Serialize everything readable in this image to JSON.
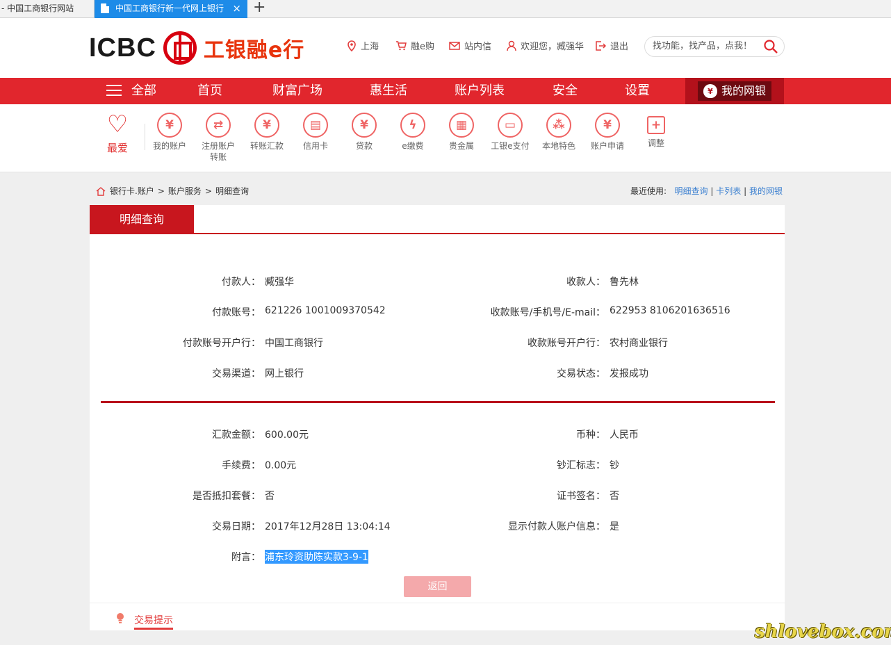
{
  "browser": {
    "prev_tab": "- 中国工商银行网站",
    "active_tab": "中国工商银行新一代网上银行",
    "close_glyph": "×",
    "new_tab_glyph": "+"
  },
  "header": {
    "logo_text": "ICBC",
    "logo_cn": "工银融e行",
    "nav": [
      {
        "icon": "location-pin-icon",
        "label": "上海"
      },
      {
        "icon": "cart-icon",
        "label": "融e购"
      },
      {
        "icon": "mail-icon",
        "label": "站内信"
      },
      {
        "icon": "user-icon",
        "label": "欢迎您，臧强华"
      },
      {
        "icon": "logout-icon",
        "label": "退出"
      }
    ],
    "search_placeholder": "找功能，找产品，点我！"
  },
  "navbar": {
    "items": [
      "全部",
      "首页",
      "财富广场",
      "惠生活",
      "账户列表",
      "安全",
      "设置"
    ],
    "my_bank": "我的网银",
    "my_bank_glyph": "¥"
  },
  "shortcuts": {
    "favorite": "最爱",
    "items": [
      {
        "label": "我的账户",
        "glyph": "¥",
        "icon": "yen-circle-icon"
      },
      {
        "label": "注册账户转账",
        "glyph": "⇄",
        "icon": "register-transfer-icon"
      },
      {
        "label": "转账汇款",
        "glyph": "¥",
        "icon": "transfer-icon"
      },
      {
        "label": "信用卡",
        "glyph": "▤",
        "icon": "credit-card-icon"
      },
      {
        "label": "贷款",
        "glyph": "¥",
        "icon": "loan-bag-icon"
      },
      {
        "label": "e缴费",
        "glyph": "ϟ",
        "icon": "payment-drop-icon"
      },
      {
        "label": "贵金属",
        "glyph": "▦",
        "icon": "gold-bars-icon"
      },
      {
        "label": "工银e支付",
        "glyph": "▭",
        "icon": "epay-card-icon"
      },
      {
        "label": "本地特色",
        "glyph": "⁂",
        "icon": "local-feature-icon"
      },
      {
        "label": "账户申请",
        "glyph": "¥",
        "icon": "account-apply-icon"
      },
      {
        "label": "调整",
        "glyph": "+",
        "icon": "adjust-plus-icon"
      }
    ]
  },
  "breadcrumb": [
    "银行卡.账户",
    "账户服务",
    "明细查询"
  ],
  "recent": {
    "label": "最近使用:",
    "links": [
      "明细查询",
      "卡列表",
      "我的网银"
    ],
    "sep": "|"
  },
  "panel": {
    "tab": "明细查询",
    "top_rows": [
      {
        "left_label": "付款人：",
        "left_value": "臧强华",
        "right_label": "收款人：",
        "right_value": "鲁先林"
      },
      {
        "left_label": "付款账号：",
        "left_value": "621226 1001009370542",
        "right_label": "收款账号/手机号/E-mail：",
        "right_value": "622953 8106201636516"
      },
      {
        "left_label": "付款账号开户行：",
        "left_value": "中国工商银行",
        "right_label": "收款账号开户行：",
        "right_value": "农村商业银行"
      },
      {
        "left_label": "交易渠道：",
        "left_value": "网上银行",
        "right_label": "交易状态：",
        "right_value": "发报成功"
      }
    ],
    "bottom_rows": [
      {
        "left_label": "汇款金额：",
        "left_value": "600.00元",
        "right_label": "币种：",
        "right_value": "人民币"
      },
      {
        "left_label": "手续费：",
        "left_value": "0.00元",
        "right_label": "钞汇标志：",
        "right_value": "钞"
      },
      {
        "left_label": "是否抵扣套餐：",
        "left_value": "否",
        "right_label": "证书签名：",
        "right_value": "否"
      },
      {
        "left_label": "交易日期：",
        "left_value": "2017年12月28日 13:04:14",
        "right_label": "显示付款人账户信息：",
        "right_value": "是"
      }
    ],
    "memo_label": "附言：",
    "memo_value": "浦东玲资助陈实款3-9-1",
    "return_button": "返回",
    "tips_label": "交易提示"
  },
  "watermark": "shlovebox.com",
  "colors": {
    "brand_red": "#e1262d",
    "dark_red": "#c8161e",
    "link_blue": "#3a7fd0",
    "selection_blue": "#3399ff"
  }
}
